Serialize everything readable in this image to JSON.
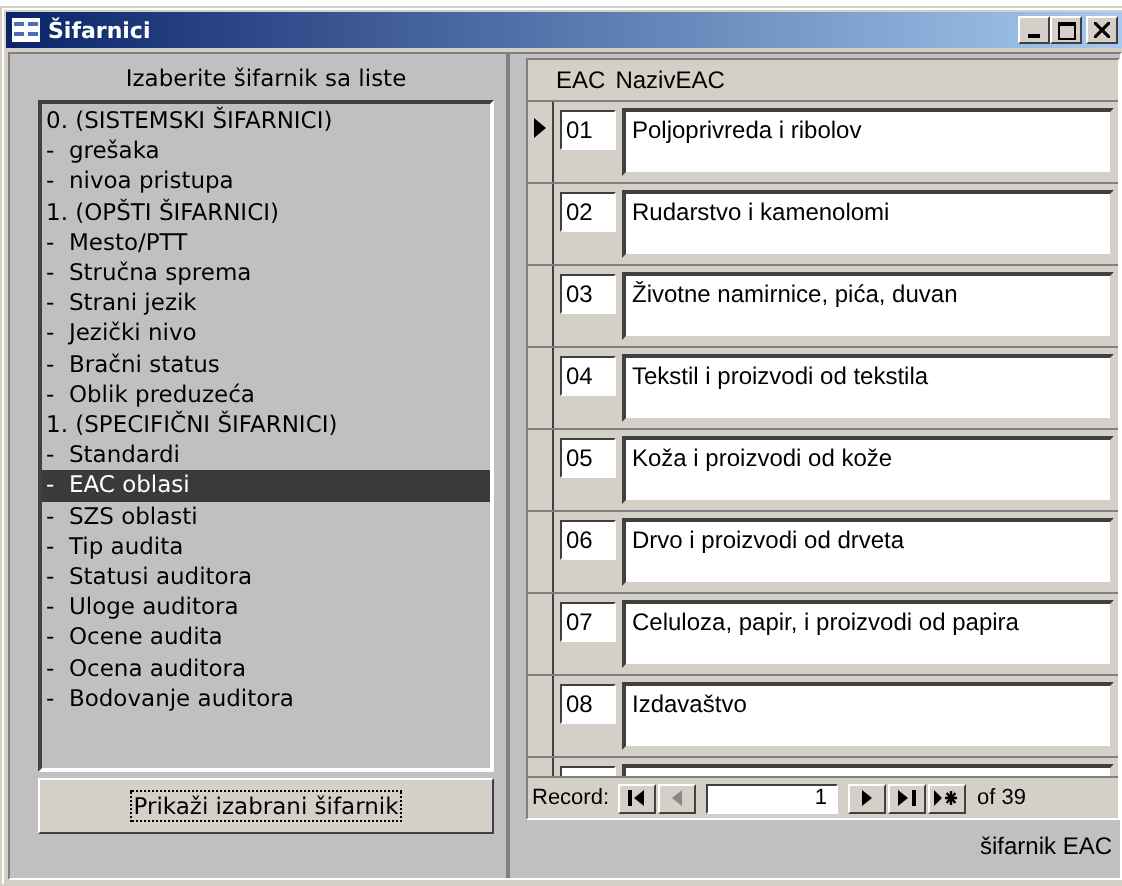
{
  "window": {
    "title": "Šifarnici"
  },
  "list_panel": {
    "heading": "Izaberite šifarnik sa liste",
    "items": [
      {
        "label": "0. (SISTEMSKI ŠIFARNICI)",
        "selected": false
      },
      {
        "label": "-  grešaka",
        "selected": false
      },
      {
        "label": "-  nivoa pristupa",
        "selected": false
      },
      {
        "label": "1. (OPŠTI ŠIFARNICI)",
        "selected": false
      },
      {
        "label": "-  Mesto/PTT",
        "selected": false
      },
      {
        "label": "-  Stručna sprema",
        "selected": false
      },
      {
        "label": "-  Strani jezik",
        "selected": false
      },
      {
        "label": "-  Jezički nivo",
        "selected": false
      },
      {
        "label": "-  Bračni status",
        "selected": false
      },
      {
        "label": "-  Oblik preduzeća",
        "selected": false
      },
      {
        "label": "1. (SPECIFIČNI ŠIFARNICI)",
        "selected": false
      },
      {
        "label": "-  Standardi",
        "selected": false
      },
      {
        "label": "-  EAC oblasi",
        "selected": true
      },
      {
        "label": "-  SZS oblasti",
        "selected": false
      },
      {
        "label": "-  Tip audita",
        "selected": false
      },
      {
        "label": "-  Statusi auditora",
        "selected": false
      },
      {
        "label": "-  Uloge auditora",
        "selected": false
      },
      {
        "label": "-  Ocene audita",
        "selected": false
      },
      {
        "label": "-  Ocena auditora",
        "selected": false
      },
      {
        "label": "-  Bodovanje auditora",
        "selected": false
      }
    ],
    "button": "Prikaži izabrani šifarnik"
  },
  "table": {
    "columns": [
      "EAC",
      "NazivEAC"
    ],
    "rows": [
      {
        "eac": "01",
        "name": "Poljoprivreda i ribolov",
        "current": true
      },
      {
        "eac": "02",
        "name": "Rudarstvo i kamenolomi",
        "current": false
      },
      {
        "eac": "03",
        "name": "Životne namirnice, pića, duvan",
        "current": false
      },
      {
        "eac": "04",
        "name": "Tekstil i proizvodi od tekstila",
        "current": false
      },
      {
        "eac": "05",
        "name": "Koža i proizvodi od kože",
        "current": false
      },
      {
        "eac": "06",
        "name": "Drvo i proizvodi od drveta",
        "current": false
      },
      {
        "eac": "07",
        "name": "Celuloza, papir, i proizvodi od papira",
        "current": false
      },
      {
        "eac": "08",
        "name": "Izdavaštvo",
        "current": false
      }
    ]
  },
  "navigator": {
    "label": "Record:",
    "value": "1",
    "total": "of 39"
  },
  "footer": "šifarnik EAC"
}
